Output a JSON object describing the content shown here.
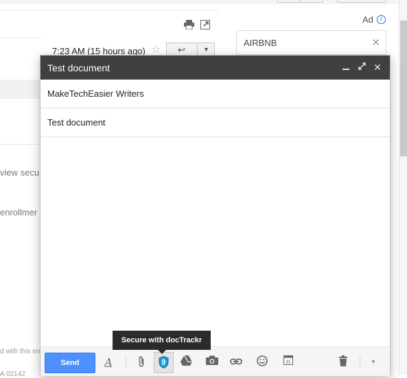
{
  "background": {
    "timestamp": "7:23 AM (15 hours ago)",
    "snippet_lines": [
      "!",
      "view secu",
      "enrollmer",
      "d with this en",
      "A 02142"
    ]
  },
  "sidebar": {
    "ad_label": "Ad",
    "search_value": "AIRBNB"
  },
  "compose": {
    "title": "Test document",
    "to": "MakeTechEasier Writers",
    "subject": "Test document",
    "send_label": "Send",
    "tooltip": "Secure with docTrackr",
    "accent_color": "#4d90fe",
    "header_color": "#404040"
  }
}
